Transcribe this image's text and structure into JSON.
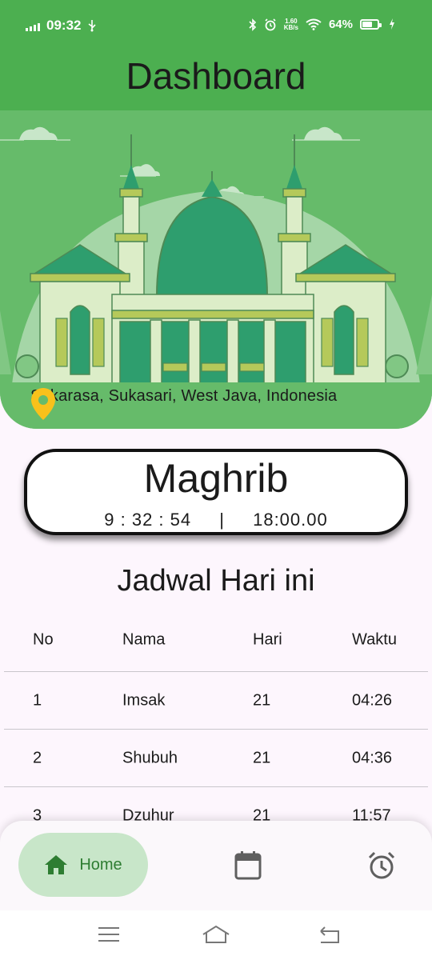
{
  "status_bar": {
    "time": "09:32",
    "net_speed": "1.60",
    "net_speed_unit": "KB/s",
    "battery": "64%",
    "battery_level": 0.64,
    "icons": [
      "signal-icon",
      "usb-icon",
      "bluetooth-icon",
      "alarm-icon",
      "wifi-icon",
      "battery-icon",
      "charging-icon"
    ]
  },
  "app_bar": {
    "title": "Dashboard"
  },
  "hero": {
    "illustration": "mosque-illustration",
    "location": "Sukarasa, Sukasari, West Java, Indonesia",
    "location_icon": "location-pin-icon"
  },
  "prayer_card": {
    "name": "Maghrib",
    "countdown": "9 : 32 : 54",
    "separator": "|",
    "time": "18:00.00"
  },
  "schedule": {
    "title": "Jadwal Hari ini",
    "columns": [
      "No",
      "Nama",
      "Hari",
      "Waktu"
    ],
    "rows": [
      [
        "1",
        "Imsak",
        "21",
        "04:26"
      ],
      [
        "2",
        "Shubuh",
        "21",
        "04:36"
      ],
      [
        "3",
        "Dzuhur",
        "21",
        "11:57"
      ]
    ]
  },
  "bottom_nav": {
    "home_label": "Home",
    "items": [
      "home-icon",
      "calendar-icon",
      "alarm-clock-icon"
    ]
  },
  "colors": {
    "primary": "#4caf50",
    "hero_bg": "#66bb6a",
    "nav_active": "#c8e6c9",
    "pin": "#f9c11b"
  }
}
